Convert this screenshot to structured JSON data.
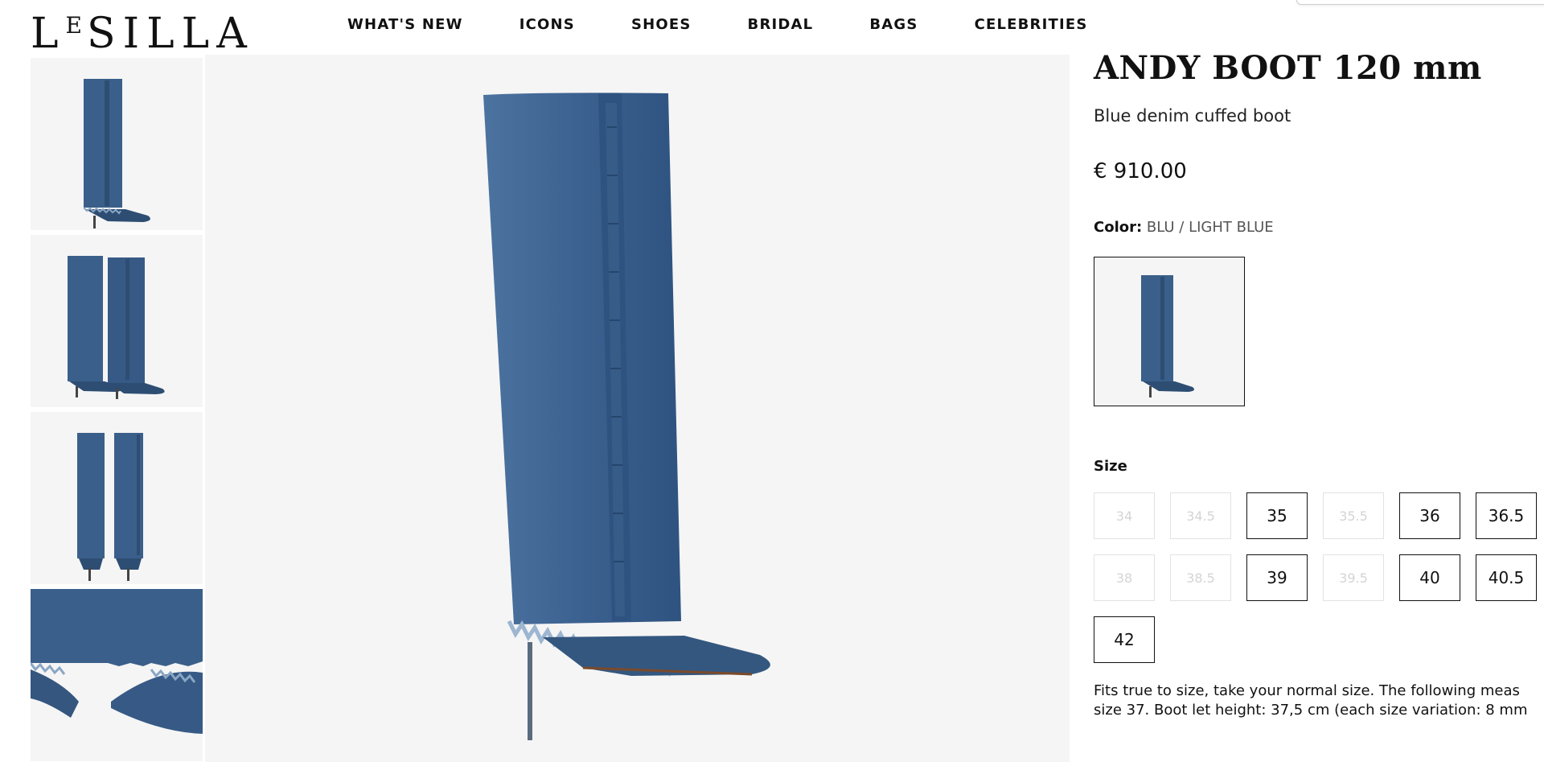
{
  "brand": {
    "logo_first": "L",
    "logo_sup": "E",
    "logo_rest": "SILLA"
  },
  "nav": [
    "WHAT'S NEW",
    "ICONS",
    "SHOES",
    "BRIDAL",
    "BAGS",
    "CELEBRITIES"
  ],
  "product": {
    "title": "ANDY BOOT 120 mm",
    "subtitle": "Blue denim cuffed boot",
    "price": "€ 910.00",
    "color_label": "Color:",
    "color_value": "BLU / LIGHT BLUE",
    "size_label": "Size",
    "sizes": [
      {
        "label": "34",
        "available": false
      },
      {
        "label": "34.5",
        "available": false
      },
      {
        "label": "35",
        "available": true
      },
      {
        "label": "35.5",
        "available": false
      },
      {
        "label": "36",
        "available": true
      },
      {
        "label": "36.5",
        "available": true
      },
      {
        "label": "38",
        "available": false
      },
      {
        "label": "38.5",
        "available": false
      },
      {
        "label": "39",
        "available": true
      },
      {
        "label": "39.5",
        "available": false
      },
      {
        "label": "40",
        "available": true
      },
      {
        "label": "40.5",
        "available": true
      },
      {
        "label": "42",
        "available": true
      }
    ],
    "description_line1": "Fits true to size, take your normal size. The following meas",
    "description_line2": "size 37. Boot let height: 37,5 cm (each size variation: 8 mm"
  },
  "colors": {
    "denim": "#3a5f8a",
    "denim_dark": "#2e4d73",
    "denim_light": "#5b7fa6",
    "image_bg": "#f5f5f5"
  }
}
